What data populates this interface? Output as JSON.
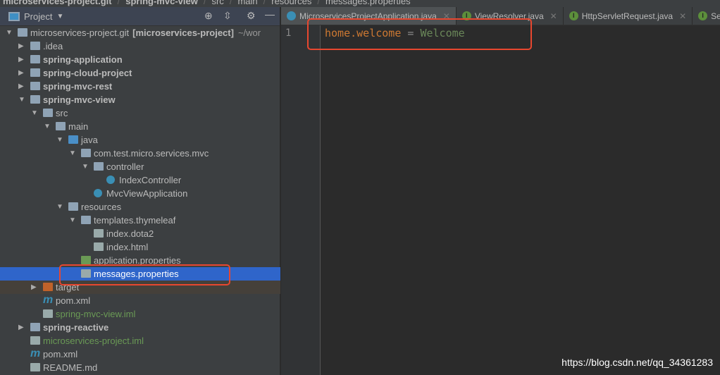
{
  "breadcrumb": [
    "microservices-project.git",
    "spring-mvc-view",
    "src",
    "main",
    "resources",
    "messages.properties"
  ],
  "panel": {
    "title": "Project",
    "icons": [
      "locate-icon",
      "collapse-icon",
      "gear-icon",
      "minimize-icon"
    ]
  },
  "tree": [
    {
      "level": 0,
      "arrow": "open",
      "icon": "module",
      "text": "microservices-project.git",
      "extra": "[microservices-project]",
      "path": "~/wor"
    },
    {
      "level": 1,
      "arrow": "closed",
      "icon": "folder",
      "text": ".idea"
    },
    {
      "level": 1,
      "arrow": "closed",
      "icon": "module",
      "text": "spring-application",
      "style": "bold"
    },
    {
      "level": 1,
      "arrow": "closed",
      "icon": "module",
      "text": "spring-cloud-project",
      "style": "bold"
    },
    {
      "level": 1,
      "arrow": "closed",
      "icon": "module",
      "text": "spring-mvc-rest",
      "style": "bold"
    },
    {
      "level": 1,
      "arrow": "open",
      "icon": "module",
      "text": "spring-mvc-view",
      "style": "bold"
    },
    {
      "level": 2,
      "arrow": "open",
      "icon": "folder",
      "text": "src"
    },
    {
      "level": 3,
      "arrow": "open",
      "icon": "folder",
      "text": "main"
    },
    {
      "level": 4,
      "arrow": "open",
      "icon": "source-folder",
      "text": "java"
    },
    {
      "level": 5,
      "arrow": "open",
      "icon": "package",
      "text": "com.test.micro.services.mvc"
    },
    {
      "level": 6,
      "arrow": "open",
      "icon": "package",
      "text": "controller"
    },
    {
      "level": 7,
      "arrow": "none",
      "icon": "class",
      "text": "IndexController"
    },
    {
      "level": 6,
      "arrow": "none",
      "icon": "spring-class",
      "text": "MvcViewApplication"
    },
    {
      "level": 4,
      "arrow": "open",
      "icon": "resources-folder",
      "text": "resources"
    },
    {
      "level": 5,
      "arrow": "open",
      "icon": "package",
      "text": "templates.thymeleaf"
    },
    {
      "level": 6,
      "arrow": "none",
      "icon": "file",
      "text": "index.dota2"
    },
    {
      "level": 6,
      "arrow": "none",
      "icon": "html",
      "text": "index.html"
    },
    {
      "level": 5,
      "arrow": "none",
      "icon": "spring-properties",
      "text": "application.properties"
    },
    {
      "level": 5,
      "arrow": "none",
      "icon": "properties",
      "text": "messages.properties",
      "selected": true
    },
    {
      "level": 2,
      "arrow": "closed",
      "icon": "excluded-folder",
      "text": "target",
      "excluded": true
    },
    {
      "level": 2,
      "arrow": "none",
      "icon": "maven",
      "text": "pom.xml"
    },
    {
      "level": 2,
      "arrow": "none",
      "icon": "iml",
      "text": "spring-mvc-view.iml",
      "style": "green"
    },
    {
      "level": 1,
      "arrow": "closed",
      "icon": "module",
      "text": "spring-reactive",
      "style": "bold"
    },
    {
      "level": 1,
      "arrow": "none",
      "icon": "iml",
      "text": "microservices-project.iml",
      "style": "green"
    },
    {
      "level": 1,
      "arrow": "none",
      "icon": "maven",
      "text": "pom.xml"
    },
    {
      "level": 1,
      "arrow": "none",
      "icon": "markdown",
      "text": "README.md"
    }
  ],
  "tabs": [
    {
      "label": "MicroservicesProjectApplication.java",
      "icon": "spring-app"
    },
    {
      "label": "ViewResolver.java",
      "icon": "interface"
    },
    {
      "label": "HttpServletRequest.java",
      "icon": "interface"
    },
    {
      "label": "ServletR",
      "icon": "interface"
    }
  ],
  "editor": {
    "line": "1",
    "key": "home.welcome",
    "eq": "=",
    "value": "Welcome"
  },
  "watermark": "https://blog.csdn.net/qq_34361283",
  "colors": {
    "selection": "#2f65ca",
    "highlight_box": "#e8472f",
    "key": "#cc7832",
    "value": "#6a8759"
  }
}
